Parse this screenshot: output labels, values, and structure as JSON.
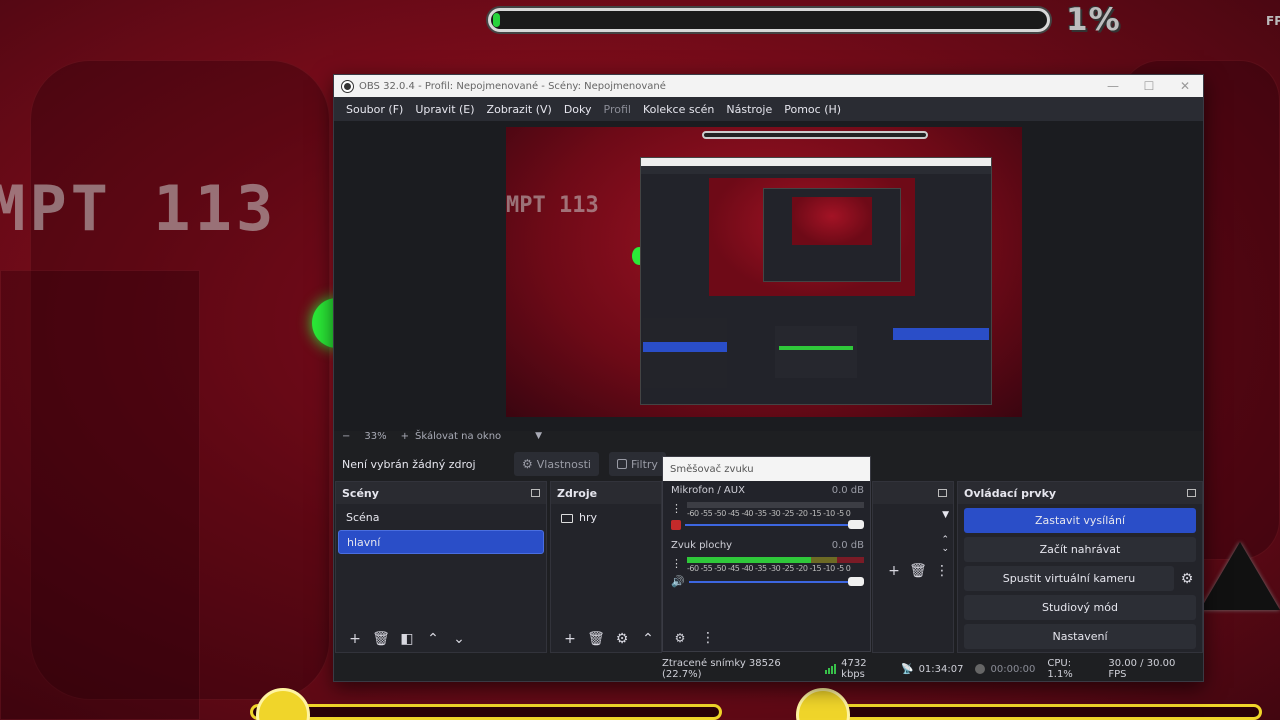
{
  "game": {
    "progress_percent": "1%",
    "progress_fraction": 0.01,
    "attempt_text": "MPT 113",
    "fps_label": "FP"
  },
  "window": {
    "title": "OBS 32.0.4 - Profil: Nepojmenované - Scény: Nepojmenované",
    "minimize": "—",
    "maximize": "☐",
    "close": "✕"
  },
  "menu": [
    {
      "label": "Soubor (F)"
    },
    {
      "label": "Upravit (E)"
    },
    {
      "label": "Zobrazit (V)"
    },
    {
      "label": "Doky"
    },
    {
      "label": "Profil"
    },
    {
      "label": "Kolekce scén"
    },
    {
      "label": "Nástroje"
    },
    {
      "label": "Pomoc (H)"
    }
  ],
  "preview_toolbar": {
    "zoom_out": "−",
    "zoom": "33%",
    "zoom_in": "+",
    "scale_label": "Škálovat na okno"
  },
  "context": {
    "no_source": "Není vybrán žádný zdroj",
    "properties": "Vlastnosti",
    "filters": "Filtry"
  },
  "scenes": {
    "title": "Scény",
    "items": [
      {
        "label": "Scéna",
        "selected": false
      },
      {
        "label": "hlavní",
        "selected": true
      }
    ]
  },
  "sources": {
    "title": "Zdroje",
    "items": [
      {
        "label": "hry"
      }
    ]
  },
  "mixer": {
    "title": "Směšovač zvuku",
    "channels": [
      {
        "name": "Mikrofon / AUX",
        "db": "0.0 dB",
        "level": 0.0,
        "muted": true
      },
      {
        "name": "Zvuk plochy",
        "db": "0.0 dB",
        "level": 0.7,
        "muted": false
      }
    ],
    "ticks": "-60 -55 -50 -45 -40 -35 -30 -25 -20 -15 -10 -5 0"
  },
  "controls": {
    "title": "Ovládací prvky",
    "stop_stream": "Zastavit vysílání",
    "start_record": "Začít nahrávat",
    "virtual_cam": "Spustit virtuální kameru",
    "studio_mode": "Studiový mód",
    "settings": "Nastavení"
  },
  "status": {
    "dropped": "Ztracené snímky 38526 (22.7%)",
    "bitrate": "4732 kbps",
    "stream_time": "01:34:07",
    "rec_time": "00:00:00",
    "cpu": "CPU: 1.1%",
    "fps": "30.00 / 30.00 FPS"
  },
  "colors": {
    "accent": "#2a4ec8",
    "game_red": "#a31325",
    "meter_green": "#2fc83a"
  }
}
